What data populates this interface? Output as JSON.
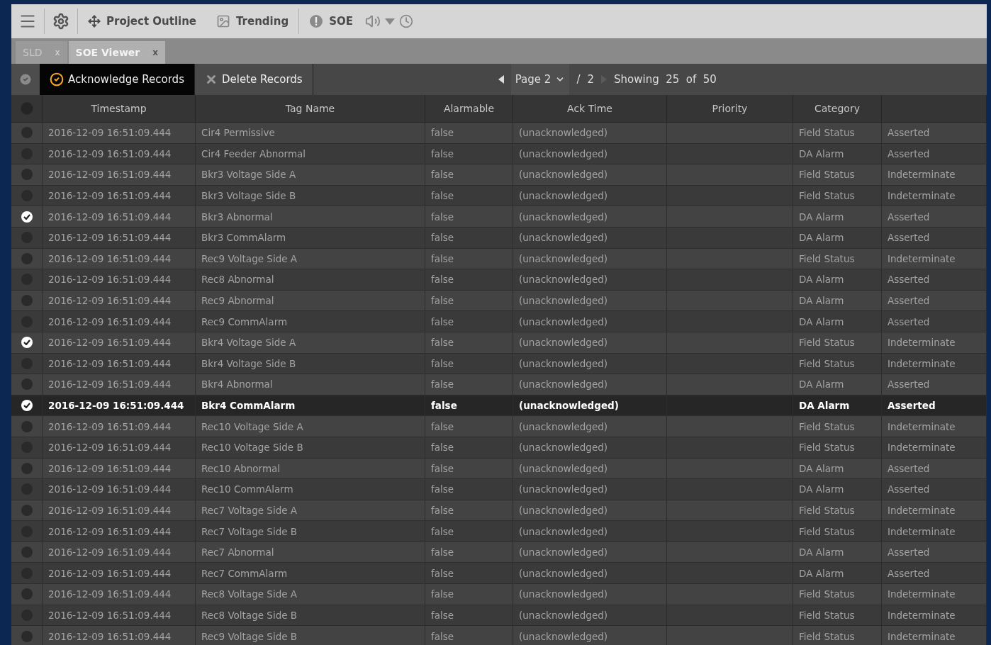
{
  "toolbar": {
    "items": [
      {
        "kind": "button",
        "label": "Project Outline"
      },
      {
        "kind": "button",
        "label": "Trending"
      },
      {
        "kind": "divider"
      },
      {
        "kind": "button",
        "label": "SOE"
      }
    ]
  },
  "tabs": [
    {
      "label": "SLD",
      "close": "x",
      "selected": false
    },
    {
      "label": "SOE Viewer",
      "close": "x",
      "selected": true
    }
  ],
  "actions": [
    {
      "label": "Acknowledge Records",
      "selected": true
    },
    {
      "label": "Delete Records",
      "selected": false
    }
  ],
  "pager": {
    "page": "Page 2",
    "slash": "/",
    "total": "2",
    "showing": "Showing  25  of  50"
  },
  "table": {
    "all_checked": false,
    "columns": [
      "Timestamp",
      "Tag Name",
      "Alarmable",
      "Ack Time",
      "Priority",
      "Category"
    ],
    "rows": [
      {
        "timestamp": "2016-12-09 16:51:09.444",
        "tag_name": "Cir4 Permissive",
        "alarmable": "false",
        "ack_time": "(unacknowledged)",
        "category": "Field Status",
        "column_7": "Asserted",
        "checked": false,
        "selected": false
      },
      {
        "timestamp": "2016-12-09 16:51:09.444",
        "tag_name": "Cir4 Feeder Abnormal",
        "alarmable": "false",
        "ack_time": "(unacknowledged)",
        "category": "DA Alarm",
        "column_7": "Asserted",
        "checked": false,
        "selected": false
      },
      {
        "timestamp": "2016-12-09 16:51:09.444",
        "tag_name": "Bkr3 Voltage Side A",
        "alarmable": "false",
        "ack_time": "(unacknowledged)",
        "category": "Field Status",
        "column_7": "Indeterminate",
        "checked": false,
        "selected": false
      },
      {
        "timestamp": "2016-12-09 16:51:09.444",
        "tag_name": "Bkr3 Voltage Side B",
        "alarmable": "false",
        "ack_time": "(unacknowledged)",
        "category": "Field Status",
        "column_7": "Indeterminate",
        "checked": false,
        "selected": false
      },
      {
        "timestamp": "2016-12-09 16:51:09.444",
        "tag_name": "Bkr3 Abnormal",
        "alarmable": "false",
        "ack_time": "(unacknowledged)",
        "category": "DA Alarm",
        "column_7": "Asserted",
        "checked": true,
        "selected": false
      },
      {
        "timestamp": "2016-12-09 16:51:09.444",
        "tag_name": "Bkr3 CommAlarm",
        "alarmable": "false",
        "ack_time": "(unacknowledged)",
        "category": "DA Alarm",
        "column_7": "Asserted",
        "checked": false,
        "selected": false
      },
      {
        "timestamp": "2016-12-09 16:51:09.444",
        "tag_name": "Rec9 Voltage Side A",
        "alarmable": "false",
        "ack_time": "(unacknowledged)",
        "category": "Field Status",
        "column_7": "Indeterminate",
        "checked": false,
        "selected": false
      },
      {
        "timestamp": "2016-12-09 16:51:09.444",
        "tag_name": "Rec8 Abnormal",
        "alarmable": "false",
        "ack_time": "(unacknowledged)",
        "category": "DA Alarm",
        "column_7": "Asserted",
        "checked": false,
        "selected": false
      },
      {
        "timestamp": "2016-12-09 16:51:09.444",
        "tag_name": "Rec9 Abnormal",
        "alarmable": "false",
        "ack_time": "(unacknowledged)",
        "category": "DA Alarm",
        "column_7": "Asserted",
        "checked": false,
        "selected": false
      },
      {
        "timestamp": "2016-12-09 16:51:09.444",
        "tag_name": "Rec9 CommAlarm",
        "alarmable": "false",
        "ack_time": "(unacknowledged)",
        "category": "DA Alarm",
        "column_7": "Asserted",
        "checked": false,
        "selected": false
      },
      {
        "timestamp": "2016-12-09 16:51:09.444",
        "tag_name": "Bkr4 Voltage Side A",
        "alarmable": "false",
        "ack_time": "(unacknowledged)",
        "category": "Field Status",
        "column_7": "Indeterminate",
        "checked": true,
        "selected": false
      },
      {
        "timestamp": "2016-12-09 16:51:09.444",
        "tag_name": "Bkr4 Voltage Side B",
        "alarmable": "false",
        "ack_time": "(unacknowledged)",
        "category": "Field Status",
        "column_7": "Indeterminate",
        "checked": false,
        "selected": false
      },
      {
        "timestamp": "2016-12-09 16:51:09.444",
        "tag_name": "Bkr4 Abnormal",
        "alarmable": "false",
        "ack_time": "(unacknowledged)",
        "category": "DA Alarm",
        "column_7": "Asserted",
        "checked": false,
        "selected": false
      },
      {
        "timestamp": "2016-12-09 16:51:09.444",
        "tag_name": "Bkr4 CommAlarm",
        "alarmable": "false",
        "ack_time": "(unacknowledged)",
        "category": "DA Alarm",
        "column_7": "Asserted",
        "checked": true,
        "selected": true
      },
      {
        "timestamp": "2016-12-09 16:51:09.444",
        "tag_name": "Rec10 Voltage Side A",
        "alarmable": "false",
        "ack_time": "(unacknowledged)",
        "category": "Field Status",
        "column_7": "Indeterminate",
        "checked": false,
        "selected": false
      },
      {
        "timestamp": "2016-12-09 16:51:09.444",
        "tag_name": "Rec10 Voltage Side B",
        "alarmable": "false",
        "ack_time": "(unacknowledged)",
        "category": "Field Status",
        "column_7": "Indeterminate",
        "checked": false,
        "selected": false
      },
      {
        "timestamp": "2016-12-09 16:51:09.444",
        "tag_name": "Rec10 Abnormal",
        "alarmable": "false",
        "ack_time": "(unacknowledged)",
        "category": "DA Alarm",
        "column_7": "Asserted",
        "checked": false,
        "selected": false
      },
      {
        "timestamp": "2016-12-09 16:51:09.444",
        "tag_name": "Rec10 CommAlarm",
        "alarmable": "false",
        "ack_time": "(unacknowledged)",
        "category": "DA Alarm",
        "column_7": "Asserted",
        "checked": false,
        "selected": false
      },
      {
        "timestamp": "2016-12-09 16:51:09.444",
        "tag_name": "Rec7 Voltage Side A",
        "alarmable": "false",
        "ack_time": "(unacknowledged)",
        "category": "Field Status",
        "column_7": "Indeterminate",
        "checked": false,
        "selected": false
      },
      {
        "timestamp": "2016-12-09 16:51:09.444",
        "tag_name": "Rec7 Voltage Side B",
        "alarmable": "false",
        "ack_time": "(unacknowledged)",
        "category": "Field Status",
        "column_7": "Indeterminate",
        "checked": false,
        "selected": false
      },
      {
        "timestamp": "2016-12-09 16:51:09.444",
        "tag_name": "Rec7 Abnormal",
        "alarmable": "false",
        "ack_time": "(unacknowledged)",
        "category": "DA Alarm",
        "column_7": "Asserted",
        "checked": false,
        "selected": false
      },
      {
        "timestamp": "2016-12-09 16:51:09.444",
        "tag_name": "Rec7 CommAlarm",
        "alarmable": "false",
        "ack_time": "(unacknowledged)",
        "category": "DA Alarm",
        "column_7": "Asserted",
        "checked": false,
        "selected": false
      },
      {
        "timestamp": "2016-12-09 16:51:09.444",
        "tag_name": "Rec8 Voltage Side A",
        "alarmable": "false",
        "ack_time": "(unacknowledged)",
        "category": "Field Status",
        "column_7": "Indeterminate",
        "checked": false,
        "selected": false
      },
      {
        "timestamp": "2016-12-09 16:51:09.444",
        "tag_name": "Rec8 Voltage Side B",
        "alarmable": "false",
        "ack_time": "(unacknowledged)",
        "category": "Field Status",
        "column_7": "Indeterminate",
        "checked": false,
        "selected": false
      },
      {
        "timestamp": "2016-12-09 16:51:09.444",
        "tag_name": "Rec9 Voltage Side B",
        "alarmable": "false",
        "ack_time": "(unacknowledged)",
        "category": "Field Status",
        "column_7": "Indeterminate",
        "checked": false,
        "selected": false
      }
    ]
  }
}
